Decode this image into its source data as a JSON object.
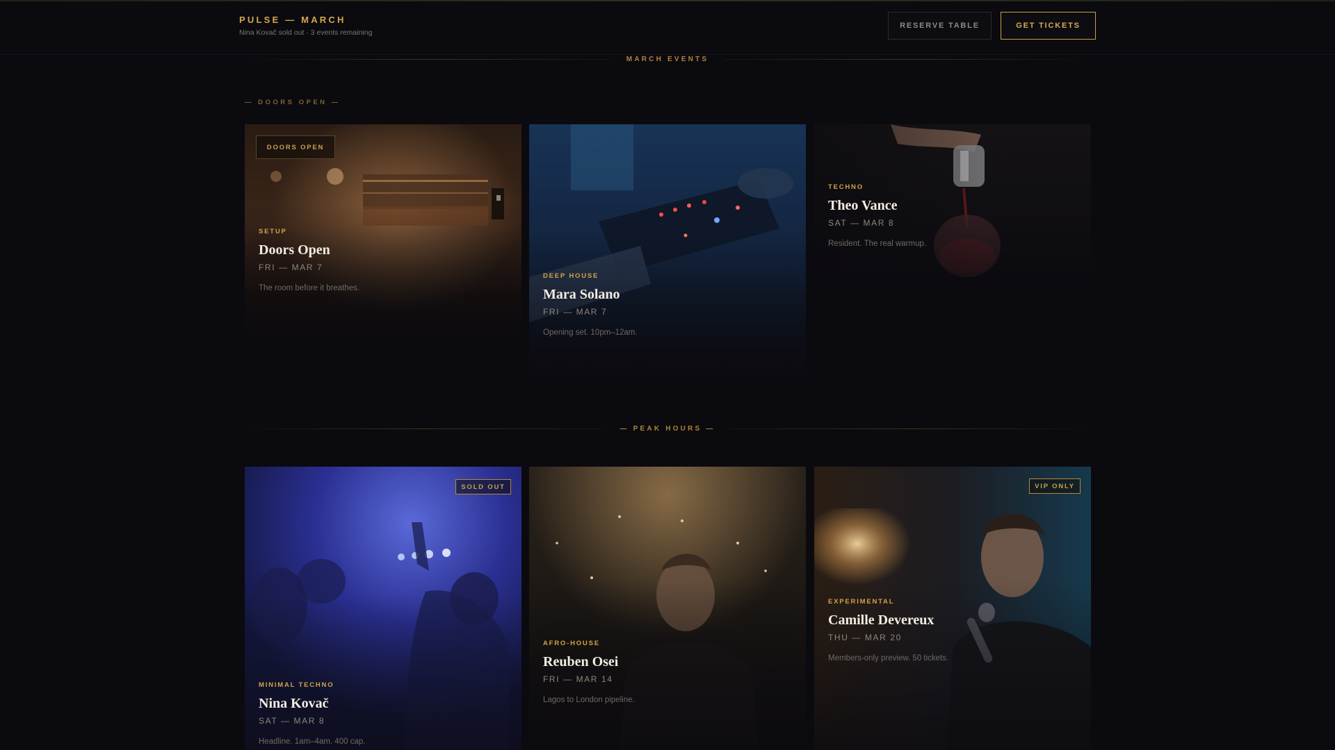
{
  "header": {
    "brand": "PULSE — MARCH",
    "subtitle": "Nina Kovač sold out · 3 events remaining",
    "reserve_label": "RESERVE TABLE",
    "tickets_label": "GET TICKETS"
  },
  "sections": {
    "march_events": "MARCH EVENTS",
    "doors_open_tag": "— DOORS OPEN —",
    "peak_hours": "— PEAK HOURS —"
  },
  "events": [
    {
      "badge": "DOORS OPEN",
      "genre": "SETUP",
      "name": "Doors Open",
      "date": "FRI — MAR 7",
      "desc": "The room before it breathes."
    },
    {
      "genre": "DEEP HOUSE",
      "name": "Mara Solano",
      "date": "FRI — MAR 7",
      "desc": "Opening set. 10pm–12am."
    },
    {
      "genre": "TECHNO",
      "name": "Theo Vance",
      "date": "SAT — MAR 8",
      "desc": "Resident. The real warmup."
    },
    {
      "badge": "SOLD OUT",
      "genre": "MINIMAL TECHNO",
      "name": "Nina Kovač",
      "date": "SAT — MAR 8",
      "desc": "Headline. 1am–4am. 400 cap."
    },
    {
      "genre": "AFRO-HOUSE",
      "name": "Reuben Osei",
      "date": "FRI — MAR 14",
      "desc": "Lagos to London pipeline."
    },
    {
      "badge": "VIP ONLY",
      "genre": "EXPERIMENTAL",
      "name": "Camille Devereux",
      "date": "THU — MAR 20",
      "desc": "Members-only preview. 50 tickets."
    }
  ],
  "colors": {
    "accent": "#d5a84f",
    "background": "#0b0a0f"
  }
}
